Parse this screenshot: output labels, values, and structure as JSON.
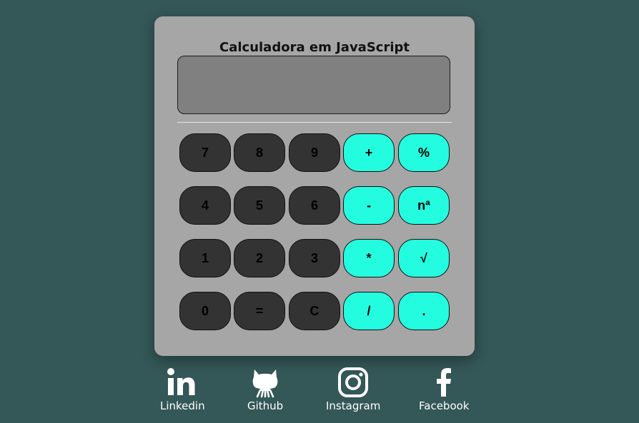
{
  "calculator": {
    "title": "Calculadora em JavaScript",
    "display_value": "",
    "buttons": [
      {
        "label": "7",
        "style": "dark",
        "name": "key-7-button"
      },
      {
        "label": "8",
        "style": "dark",
        "name": "key-8-button"
      },
      {
        "label": "9",
        "style": "dark",
        "name": "key-9-button"
      },
      {
        "label": "+",
        "style": "cyan",
        "name": "add-button"
      },
      {
        "label": "%",
        "style": "cyan",
        "name": "percent-button"
      },
      {
        "label": "4",
        "style": "dark",
        "name": "key-4-button"
      },
      {
        "label": "5",
        "style": "dark",
        "name": "key-5-button"
      },
      {
        "label": "6",
        "style": "dark",
        "name": "key-6-button"
      },
      {
        "label": "-",
        "style": "cyan",
        "name": "subtract-button"
      },
      {
        "label": "nª",
        "style": "cyan",
        "name": "power-button"
      },
      {
        "label": "1",
        "style": "dark",
        "name": "key-1-button"
      },
      {
        "label": "2",
        "style": "dark",
        "name": "key-2-button"
      },
      {
        "label": "3",
        "style": "dark",
        "name": "key-3-button"
      },
      {
        "label": "*",
        "style": "cyan",
        "name": "multiply-button"
      },
      {
        "label": "√",
        "style": "cyan",
        "name": "sqrt-button"
      },
      {
        "label": "0",
        "style": "dark",
        "name": "key-0-button"
      },
      {
        "label": "=",
        "style": "dark",
        "name": "equals-button"
      },
      {
        "label": "C",
        "style": "dark",
        "name": "clear-button"
      },
      {
        "label": "/",
        "style": "cyan",
        "name": "divide-button"
      },
      {
        "label": ".",
        "style": "cyan",
        "name": "decimal-button"
      }
    ]
  },
  "social": {
    "linkedin": {
      "label": "Linkedin",
      "icon": "linkedin-icon"
    },
    "github": {
      "label": "Github",
      "icon": "github-icon"
    },
    "instagram": {
      "label": "Instagram",
      "icon": "instagram-icon"
    },
    "facebook": {
      "label": "Facebook",
      "icon": "facebook-icon"
    }
  },
  "colors": {
    "background": "#345757",
    "calculator_body": "#a6a6a6",
    "display": "#808080",
    "number_key": "#333333",
    "operator_key": "#24fce0"
  }
}
